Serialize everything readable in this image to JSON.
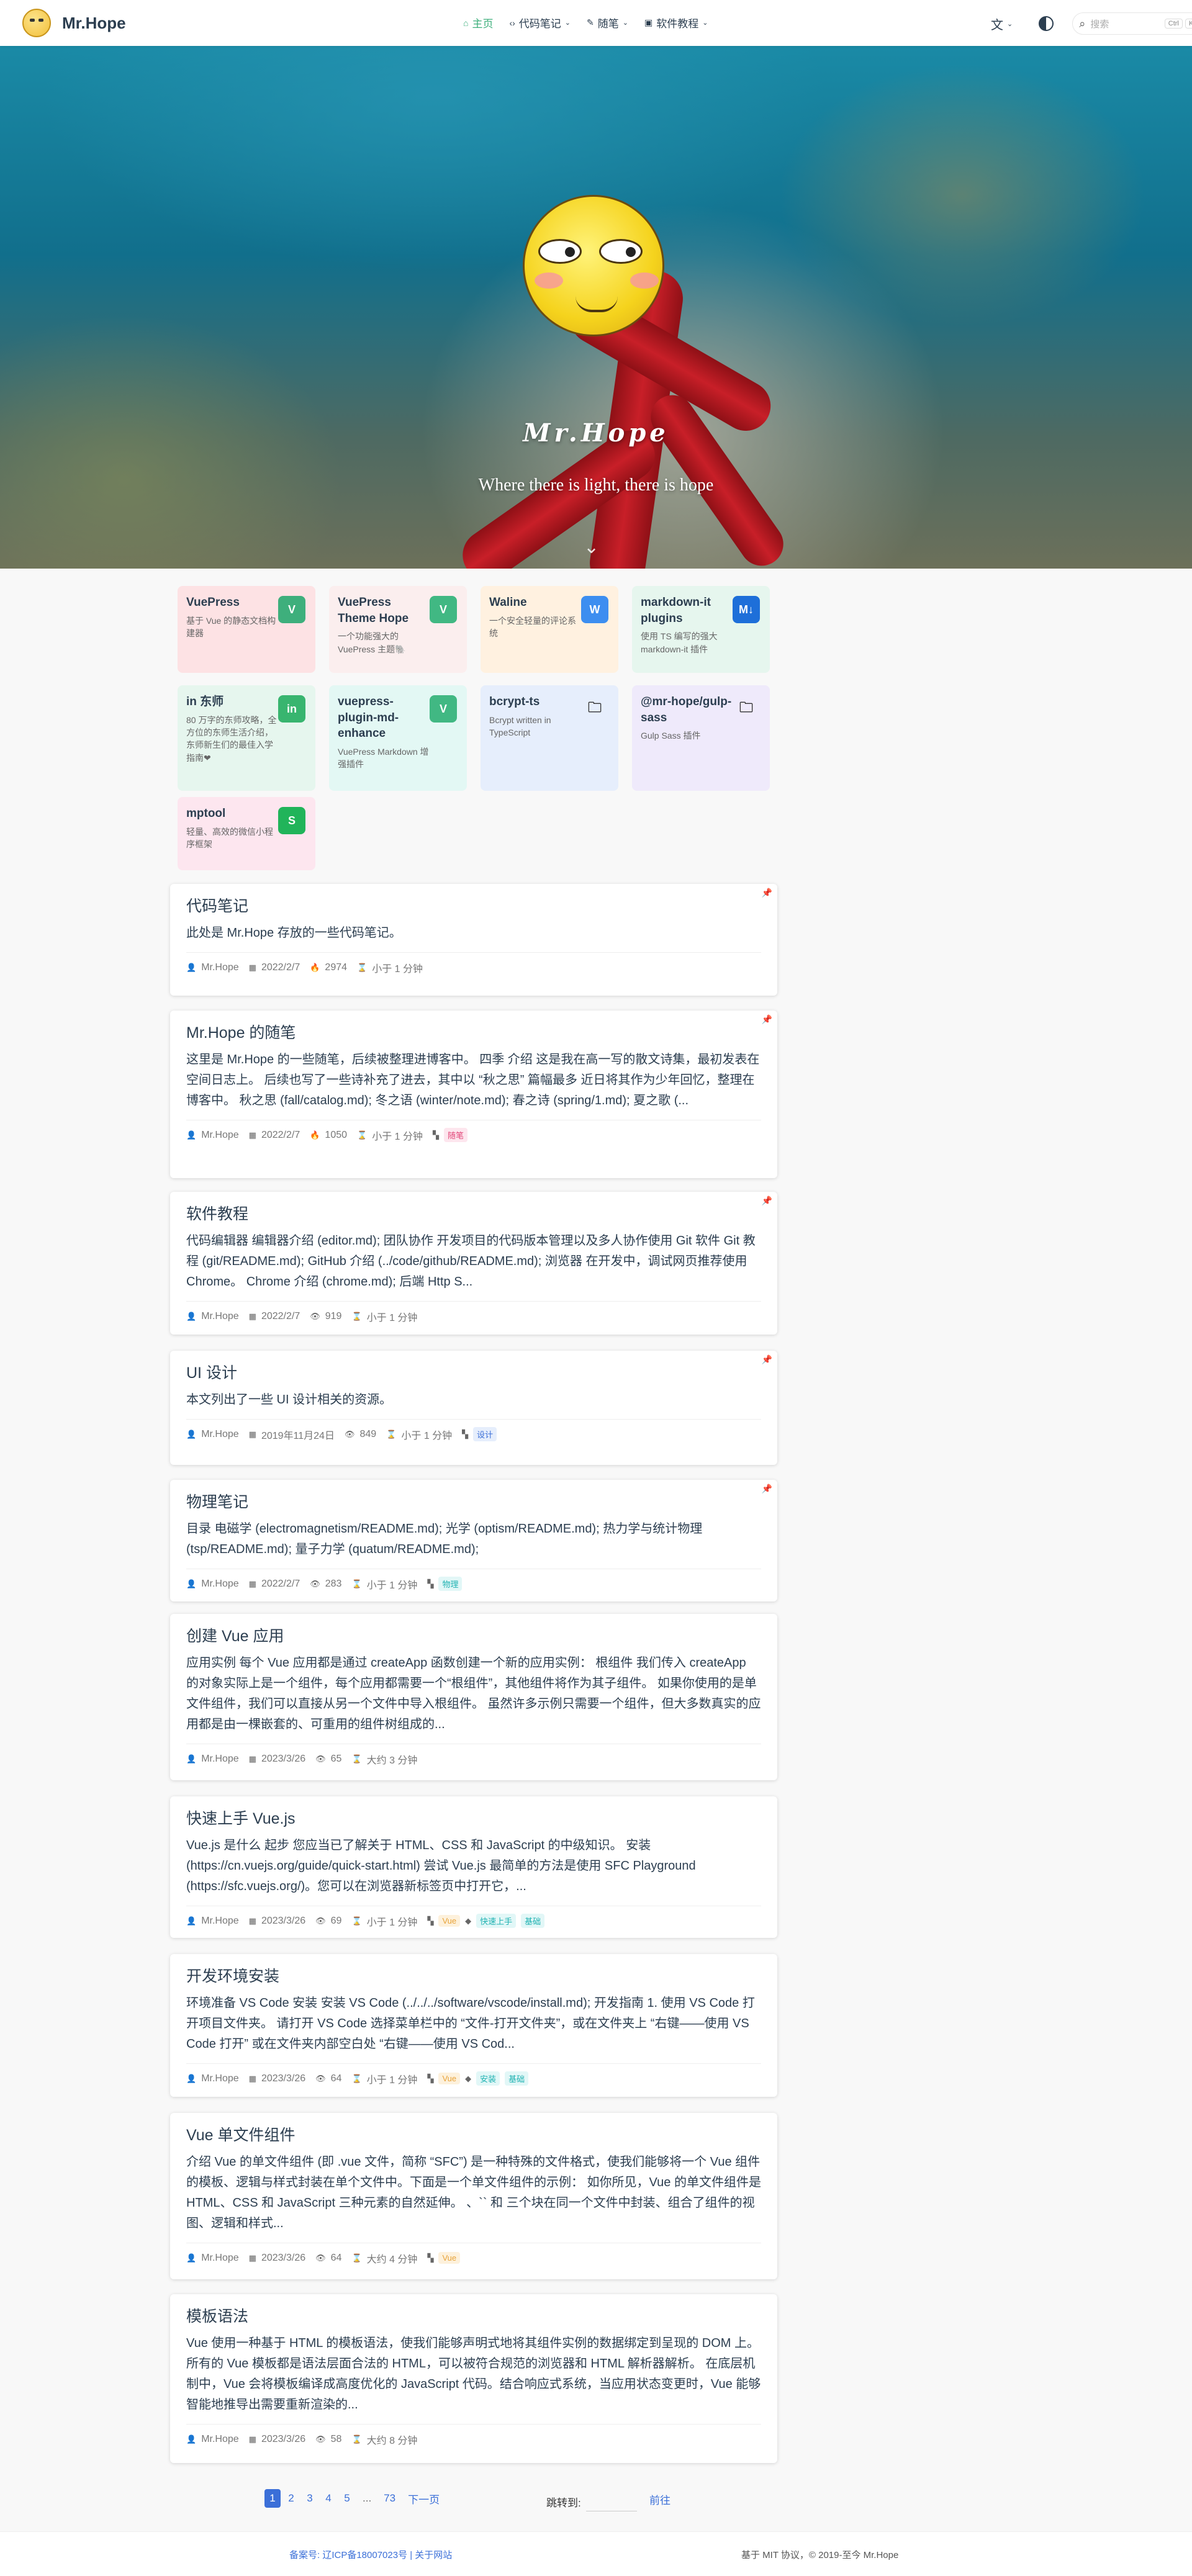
{
  "navbar": {
    "brand": "Mr.Hope",
    "items": [
      {
        "label": "主页",
        "icon": "home-icon",
        "glyph": "⌂",
        "caret": false,
        "active": true
      },
      {
        "label": "代码笔记",
        "icon": "code-icon",
        "glyph": "‹›",
        "caret": true,
        "active": false
      },
      {
        "label": "随笔",
        "icon": "note-icon",
        "glyph": "✎",
        "caret": true,
        "active": false
      },
      {
        "label": "软件教程",
        "icon": "software-icon",
        "glyph": "▣",
        "caret": true,
        "active": false
      }
    ],
    "lang_glyph": "文",
    "search_placeholder": "搜索",
    "search_keys": [
      "Ctrl",
      "K"
    ]
  },
  "hero": {
    "title": "Mr.Hope",
    "tagline": "Where there is light, there is hope"
  },
  "projects": [
    {
      "name": "VuePress",
      "desc": "基于 Vue 的静态文档构建器",
      "bg": "#fde2e4",
      "icon": "vuepress-icon",
      "glyph": "V",
      "icon_color": "#3eaf7c"
    },
    {
      "name": "VuePress Theme Hope",
      "desc": "一个功能强大的 VuePress 主题🐘",
      "bg": "#fbeeee",
      "icon": "theme-hope-icon",
      "glyph": "V",
      "icon_color": "#41b883"
    },
    {
      "name": "Waline",
      "desc": "一个安全轻量的评论系统",
      "bg": "#fff1e0",
      "icon": "waline-icon",
      "glyph": "W",
      "icon_color": "#3d8ef0"
    },
    {
      "name": "markdown-it plugins",
      "desc": "使用 TS 编写的强大 markdown-it 插件",
      "bg": "#e6f6ee",
      "icon": "markdown-icon",
      "glyph": "M↓",
      "icon_color": "#1e6fd9"
    },
    {
      "name": "in 东师",
      "desc": "80 万字的东师攻略，全方位的东师生活介绍，东师新生们的最佳入学指南❤",
      "bg": "#e6f6ee",
      "icon": "in-nenu-icon",
      "glyph": "in",
      "icon_color": "#38b56f"
    },
    {
      "name": "vuepress-plugin-md-enhance",
      "desc": "VuePress Markdown 增强插件",
      "bg": "#e3f8f4",
      "icon": "md-enhance-icon",
      "glyph": "V",
      "icon_color": "#41b883"
    },
    {
      "name": "bcrypt-ts",
      "desc": "Bcrypt written in TypeScript",
      "bg": "#e6eefc",
      "icon": "folder-icon",
      "glyph": "🗀",
      "icon_color": "transparent"
    },
    {
      "name": "@mr-hope/gulp-sass",
      "desc": "Gulp Sass 插件",
      "bg": "#efeafb",
      "icon": "folder-icon",
      "glyph": "🗀",
      "icon_color": "transparent"
    },
    {
      "name": "mptool",
      "desc": "轻量、高效的微信小程序框架",
      "bg": "#fde6ef",
      "icon": "mptool-icon",
      "glyph": "S",
      "icon_color": "#21b45a"
    }
  ],
  "articles": [
    {
      "title": "代码笔记",
      "excerpt": "此处是 Mr.Hope 存放的一些代码笔记。",
      "author": "Mr.Hope",
      "date": "2022/2/7",
      "views_icon": "fire-icon",
      "views": "2974",
      "read": "小于 1 分钟",
      "tags": [],
      "pinned": true
    },
    {
      "title": "Mr.Hope 的随笔",
      "excerpt": "这里是 Mr.Hope 的一些随笔，后续被整理进博客中。 四季 介绍 这是我在高一写的散文诗集，最初发表在空间日志上。 后续也写了一些诗补充了进去，其中以 “秋之思” 篇幅最多 近日将其作为少年回忆，整理在博客中。 秋之思 (fall/catalog.md); 冬之语 (winter/note.md); 春之诗 (spring/1.md); 夏之歌 (...",
      "author": "Mr.Hope",
      "date": "2022/2/7",
      "views_icon": "fire-icon",
      "views": "1050",
      "read": "小于 1 分钟",
      "tags": [
        {
          "label": "随笔",
          "kind": "category",
          "color": "#e2487a",
          "bg": "#fde6ee"
        }
      ],
      "pinned": true
    },
    {
      "title": "软件教程",
      "excerpt": "代码编辑器 编辑器介绍 (editor.md); 团队协作 开发项目的代码版本管理以及多人协作使用 Git 软件 Git 教程 (git/README.md); GitHub 介绍 (../code/github/README.md); 浏览器 在开发中，调试网页推荐使用 Chrome。 Chrome 介绍 (chrome.md); 后端 Http S...",
      "author": "Mr.Hope",
      "date": "2022/2/7",
      "views_icon": "eye-icon",
      "views": "919",
      "read": "小于 1 分钟",
      "tags": [],
      "pinned": true
    },
    {
      "title": "UI 设计",
      "excerpt": "本文列出了一些 UI 设计相关的资源。",
      "author": "Mr.Hope",
      "date": "2019年11月24日",
      "views_icon": "eye-icon",
      "views": "849",
      "read": "小于 1 分钟",
      "tags": [
        {
          "label": "设计",
          "kind": "category",
          "color": "#3b6fd8",
          "bg": "#e6eefc"
        }
      ],
      "pinned": true
    },
    {
      "title": "物理笔记",
      "excerpt": "目录 电磁学 (electromagnetism/README.md); 光学 (optism/README.md); 热力学与统计物理 (tsp/README.md); 量子力学 (quatum/README.md);",
      "author": "Mr.Hope",
      "date": "2022/2/7",
      "views_icon": "eye-icon",
      "views": "283",
      "read": "小于 1 分钟",
      "tags": [
        {
          "label": "物理",
          "kind": "category",
          "color": "#20b2b2",
          "bg": "#e2f7f7"
        }
      ],
      "pinned": true
    },
    {
      "title": "创建 Vue 应用",
      "excerpt": "应用实例 每个 Vue 应用都是通过 createApp 函数创建一个新的应用实例： 根组件 我们传入 createApp 的对象实际上是一个组件，每个应用都需要一个“根组件”，其他组件将作为其子组件。 如果你使用的是单文件组件，我们可以直接从另一个文件中导入根组件。 虽然许多示例只需要一个组件，但大多数真实的应用都是由一棵嵌套的、可重用的组件树组成的...",
      "author": "Mr.Hope",
      "date": "2023/3/26",
      "views_icon": "eye-icon",
      "views": "65",
      "read": "大约 3 分钟",
      "tags": [],
      "pinned": false
    },
    {
      "title": "快速上手 Vue.js",
      "excerpt": "Vue.js 是什么 起步 您应当已了解关于 HTML、CSS 和 JavaScript 的中级知识。 安装 (https://cn.vuejs.org/guide/quick-start.html) 尝试 Vue.js 最简单的方法是使用 SFC Playground (https://sfc.vuejs.org/)。您可以在浏览器新标签页中打开它，...",
      "author": "Mr.Hope",
      "date": "2023/3/26",
      "views_icon": "eye-icon",
      "views": "69",
      "read": "小于 1 分钟",
      "tags": [
        {
          "label": "Vue",
          "kind": "category",
          "color": "#e8a33a",
          "bg": "#fdf1dc"
        },
        {
          "label": "快速上手",
          "kind": "tag",
          "color": "#20b2b2",
          "bg": "#e2f7f7"
        },
        {
          "label": "基础",
          "kind": "tag",
          "color": "#20b2b2",
          "bg": "#e2f7f7"
        }
      ],
      "pinned": false
    },
    {
      "title": "开发环境安装",
      "excerpt": "环境准备 VS Code 安装 安装 VS Code (../../../software/vscode/install.md); 开发指南 1. 使用 VS Code 打开项目文件夹。 请打开 VS Code 选择菜单栏中的 “文件-打开文件夹”，或在文件夹上 “右键——使用 VS Code 打开” 或在文件夹内部空白处 “右键——使用 VS Cod...",
      "author": "Mr.Hope",
      "date": "2023/3/26",
      "views_icon": "eye-icon",
      "views": "64",
      "read": "小于 1 分钟",
      "tags": [
        {
          "label": "Vue",
          "kind": "category",
          "color": "#e8a33a",
          "bg": "#fdf1dc"
        },
        {
          "label": "安装",
          "kind": "tag",
          "color": "#20b2b2",
          "bg": "#e2f7f7"
        },
        {
          "label": "基础",
          "kind": "tag",
          "color": "#20b2b2",
          "bg": "#e2f7f7"
        }
      ],
      "pinned": false
    },
    {
      "title": "Vue 单文件组件",
      "excerpt": "介绍 Vue 的单文件组件 (即 .vue 文件，简称 “SFC”) 是一种特殊的文件格式，使我们能够将一个 Vue 组件的模板、逻辑与样式封装在单个文件中。下面是一个单文件组件的示例： 如你所见，Vue 的单文件组件是 HTML、CSS 和 JavaScript 三种元素的自然延伸。 、`` 和 三个块在同一个文件中封装、组合了组件的视图、逻辑和样式...",
      "author": "Mr.Hope",
      "date": "2023/3/26",
      "views_icon": "eye-icon",
      "views": "64",
      "read": "大约 4 分钟",
      "tags": [
        {
          "label": "Vue",
          "kind": "category",
          "color": "#e8a33a",
          "bg": "#fdf1dc"
        }
      ],
      "pinned": false
    },
    {
      "title": "模板语法",
      "excerpt": "Vue 使用一种基于 HTML 的模板语法，使我们能够声明式地将其组件实例的数据绑定到呈现的 DOM 上。所有的 Vue 模板都是语法层面合法的 HTML，可以被符合规范的浏览器和 HTML 解析器解析。 在底层机制中，Vue 会将模板编译成高度优化的 JavaScript 代码。结合响应式系统，当应用状态变更时，Vue 能够智能地推导出需要重新渲染的...",
      "author": "Mr.Hope",
      "date": "2023/3/26",
      "views_icon": "eye-icon",
      "views": "58",
      "read": "大约 8 分钟",
      "tags": [],
      "pinned": false
    }
  ],
  "pagination": {
    "pages": [
      "1",
      "2",
      "3",
      "4",
      "5",
      "...",
      "73"
    ],
    "current": "1",
    "next": "下一页",
    "jump_label": "跳转到:",
    "go": "前往"
  },
  "footer": {
    "left": "备案号: 辽ICP备18007023号 | 关于网站",
    "right": "基于 MIT 协议，© 2019-至今 Mr.Hope"
  }
}
